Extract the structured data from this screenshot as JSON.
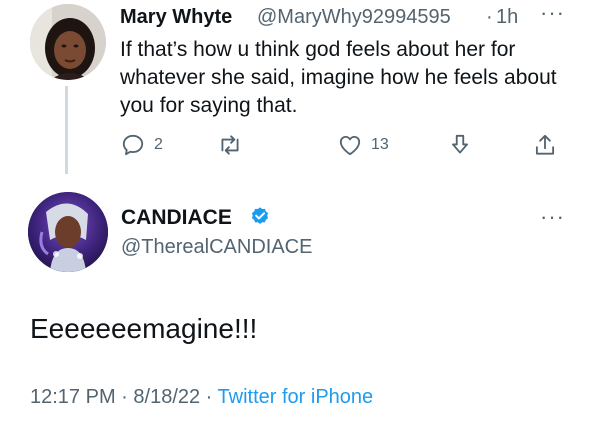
{
  "parent_tweet": {
    "name": "Mary Whyte",
    "handle": "@MaryWhy92994595",
    "separator": "·",
    "time": "1h",
    "more_label": "···",
    "text": "If that’s how u think god feels about her for whatever she said, imagine how he feels about you for saying that.",
    "actions": {
      "reply_count": "2",
      "retweet_count": "",
      "like_count": "13"
    }
  },
  "main_tweet": {
    "name": "CANDIACE",
    "handle": "@TherealCANDIACE",
    "more_label": "···",
    "text": "Eeeeeeemagine!!!",
    "time": "12:17 PM",
    "sep1": " · ",
    "date": "8/18/22",
    "sep2": " · ",
    "source": "Twitter for iPhone"
  },
  "colors": {
    "text": "#0f1419",
    "secondary": "#536471",
    "accent": "#1d9bf0",
    "thread_line": "#cfd9de"
  },
  "icons": [
    "reply-icon",
    "retweet-icon",
    "like-icon",
    "bookmark-icon",
    "share-icon",
    "verified-icon",
    "more-icon"
  ]
}
